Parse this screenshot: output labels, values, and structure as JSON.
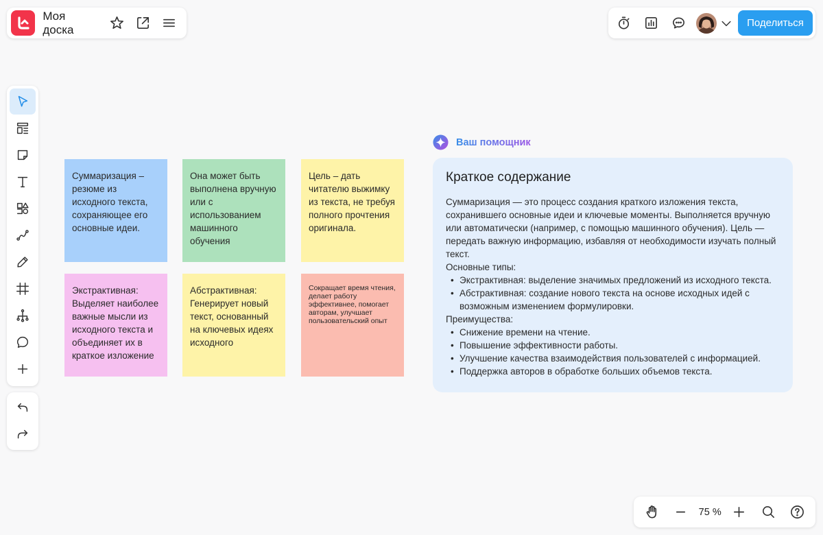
{
  "board": {
    "title": "Моя доска"
  },
  "header": {
    "share_label": "Поделиться"
  },
  "icons": {
    "logo": "logo-icon",
    "favorite": "star-icon",
    "export": "export-icon",
    "menu": "menu-icon",
    "timer": "timer-icon",
    "chart": "chart-icon",
    "chat": "chat-icon",
    "dropdown": "chevron-down-icon"
  },
  "toolbar": {
    "tools": [
      "select-icon",
      "templates-icon",
      "sticky-note-icon",
      "text-icon",
      "shapes-icon",
      "connector-icon",
      "pen-icon",
      "frame-icon",
      "mindmap-icon",
      "comment-icon",
      "plus-icon"
    ],
    "history": [
      "undo-icon",
      "redo-icon"
    ],
    "active": "select-icon"
  },
  "stickies": [
    {
      "text": "Суммаризация – резюме из исходного текста, сохраняющее его основные идеи.",
      "color": "#a8d0fb"
    },
    {
      "text": "Она может быть выполнена вручную или с использованием машинного обучения",
      "color": "#ade1bc"
    },
    {
      "text": "Цель – дать читателю  выжимку из текста, не требуя полного прочтения оригинала.",
      "color": "#fef3a8"
    },
    {
      "text": "Экстрактивная: Выделяет наиболее важные мысли из исходного текста и объединяет их в краткое изложение",
      "color": "#f6c0f0"
    },
    {
      "text": "Абстрактивная: Генерирует новый текст, основанный на ключевых идеях исходного",
      "color": "#fef3a8"
    },
    {
      "text": "Сокращает время чтения, делает работу эффективнее, помогает авторам, улучшает пользовательский опыт",
      "color": "#fbbcb0"
    }
  ],
  "assistant": {
    "label": "Ваш помощник",
    "card_title": "Краткое содержание",
    "intro": "Суммаризация — это процесс создания краткого изложения текста, сохранившего основные идеи и ключевые моменты. Выполняется вручную или автоматически (например, с помощью машинного обучения). Цель — передать важную информацию, избавляя от необходимости изучать полный текст.",
    "types_heading": "Основные типы:",
    "types": [
      "Экстрактивная: выделение значимых предложений из исходного текста.",
      "Абстрактивная: создание нового текста на основе исходных идей с возможным изменением формулировки."
    ],
    "advantages_heading": "Преимущества:",
    "advantages": [
      "Снижение времени на чтение.",
      "Повышение эффективности работы.",
      "Улучшение качества взаимодействия пользователей с информацией.",
      "Поддержка авторов в обработке больших объемов текста."
    ]
  },
  "zoom": {
    "level": "75 %",
    "icons": [
      "hand-icon",
      "zoom-out-icon",
      "zoom-in-icon",
      "search-icon",
      "help-icon"
    ]
  },
  "colors": {
    "accent": "#2a9ef0",
    "logo": "#f2344a",
    "card": "#e4effc"
  }
}
